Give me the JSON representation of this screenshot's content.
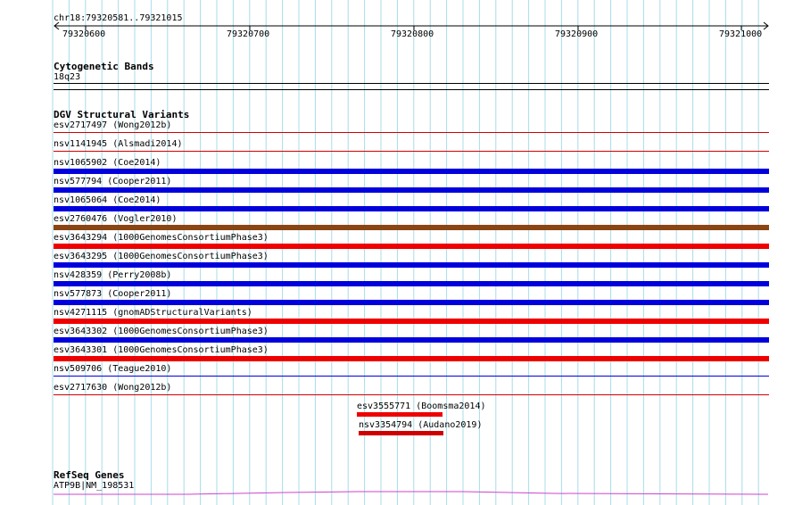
{
  "ruler": {
    "location": "chr18:79320581..79321015",
    "ticks": [
      "79320600",
      "79320700",
      "79320800",
      "79320900",
      "79321000"
    ]
  },
  "tracks": {
    "cytoband": {
      "title": "Cytogenetic Bands",
      "band": "18q23"
    },
    "dgv": {
      "title": "DGV Structural Variants",
      "rows": [
        {
          "label": "esv2717497 (Wong2012b)",
          "color": "#d00000",
          "kind": "line"
        },
        {
          "label": "nsv1141945 (Alsmadi2014)",
          "color": "#d00000",
          "kind": "line"
        },
        {
          "label": "nsv1065902 (Coe2014)",
          "color": "#0000dd",
          "kind": "bar"
        },
        {
          "label": "nsv577794 (Cooper2011)",
          "color": "#0000dd",
          "kind": "bar"
        },
        {
          "label": "nsv1065064 (Coe2014)",
          "color": "#0000dd",
          "kind": "bar"
        },
        {
          "label": "esv2760476 (Vogler2010)",
          "color": "#8b4513",
          "kind": "bar"
        },
        {
          "label": "esv3643294 (1000GenomesConsortiumPhase3)",
          "color": "#ee0000",
          "kind": "bar"
        },
        {
          "label": "esv3643295 (1000GenomesConsortiumPhase3)",
          "color": "#0000dd",
          "kind": "bar"
        },
        {
          "label": "nsv428359 (Perry2008b)",
          "color": "#0000dd",
          "kind": "bar"
        },
        {
          "label": "nsv577873 (Cooper2011)",
          "color": "#0000dd",
          "kind": "bar"
        },
        {
          "label": "nsv4271115 (gnomADStructuralVariants)",
          "color": "#ee0000",
          "kind": "bar"
        },
        {
          "label": "esv3643302 (1000GenomesConsortiumPhase3)",
          "color": "#0000dd",
          "kind": "bar"
        },
        {
          "label": "esv3643301 (1000GenomesConsortiumPhase3)",
          "color": "#ee0000",
          "kind": "bar"
        },
        {
          "label": "nsv509706 (Teague2010)",
          "color": "#0000dd",
          "kind": "line"
        },
        {
          "label": "esv2717630 (Wong2012b)",
          "color": "#d00000",
          "kind": "line"
        }
      ],
      "short": [
        {
          "label": "esv3555771 (Boomsma2014)",
          "color": "#ee0000"
        },
        {
          "label": "nsv3354794 (Audano2019)",
          "color": "#d00000"
        }
      ]
    },
    "refseq": {
      "title": "RefSeq Genes",
      "gene": "ATP9B|NM_198531",
      "color": "#cc44cc"
    }
  }
}
